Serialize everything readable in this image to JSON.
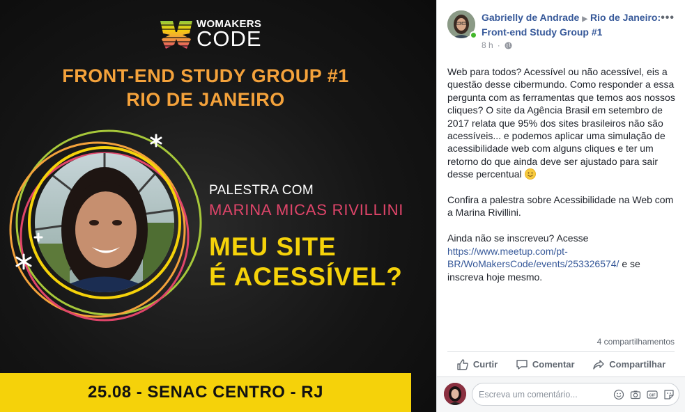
{
  "poster": {
    "logo_top": "WOMAKERS",
    "logo_bottom": "CODE",
    "title_line1": "FRONT-END STUDY GROUP #1",
    "title_line2": "RIO DE JANEIRO",
    "palestra": "PALESTRA COM",
    "speaker": "MARINA MICAS RIVILLINI",
    "talk_line1": "MEU SITE",
    "talk_line2": "É ACESSÍVEL?",
    "footer": "25.08 - SENAC CENTRO - RJ",
    "colors": {
      "orange": "#f4a23b",
      "pink": "#e0456a",
      "yellow": "#f5d20a",
      "green": "#a7c83a"
    }
  },
  "post": {
    "author": "Gabrielly de Andrade",
    "group": "Rio de Janeiro: Front-end Study Group #1",
    "time": "8 h",
    "more_icon": "ellipsis-icon",
    "body_p1": "Web para todos? Acessível ou não acessível, eis a questão desse cibermundo. Como responder a essa pergunta com as ferramentas que temos aos nossos cliques? O site da Agência Brasil em setembro de 2017 relata que 95% dos sites brasileiros não são acessíveis... e podemos aplicar uma simulação de acessibilidade web com alguns cliques e ter um retorno do que ainda deve ser ajustado para sair desse percentual",
    "body_p2": "Confira a palestra sobre Acessibilidade na Web com a Marina Rivillini.",
    "body_p3_pre": "Ainda não se inscreveu? Acesse",
    "link": "https://www.meetup.com/pt-BR/WoMakersCode/events/253326574/",
    "body_p3_post": "e se inscreva hoje mesmo.",
    "shares": "4 compartilhamentos"
  },
  "actions": {
    "like": "Curtir",
    "comment": "Comentar",
    "share": "Compartilhar"
  },
  "comment": {
    "placeholder": "Escreva um comentário..."
  }
}
